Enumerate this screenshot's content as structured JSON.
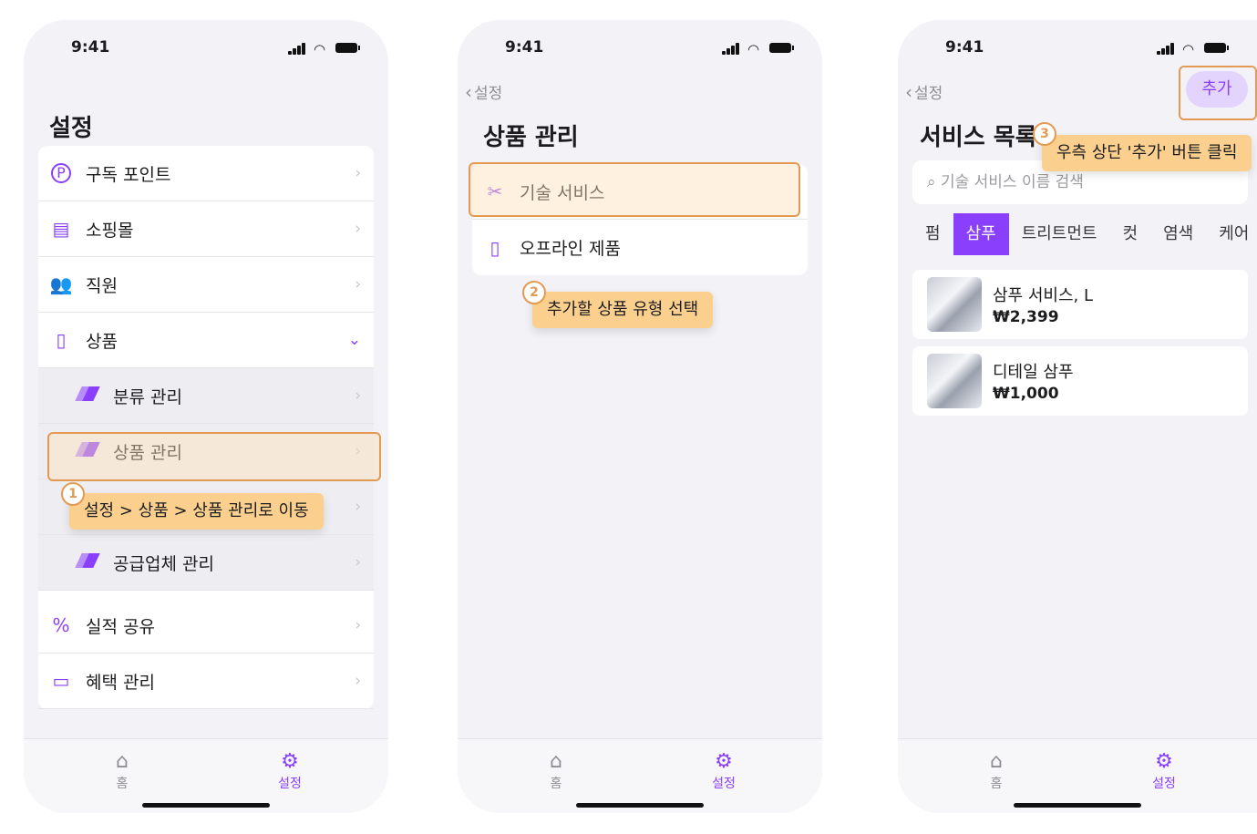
{
  "status": {
    "time": "9:41"
  },
  "screen1": {
    "title": "설정",
    "items": [
      {
        "label": "구독 포인트"
      },
      {
        "label": "소핑몰"
      },
      {
        "label": "직원"
      },
      {
        "label": "상품"
      }
    ],
    "sub_items": [
      {
        "label": "분류 관리"
      },
      {
        "label": "상품 관리"
      },
      {
        "label": "공급업체 관리"
      }
    ],
    "items2": [
      {
        "label": "실적 공유"
      },
      {
        "label": "혜택 관리"
      }
    ],
    "tip": "설정 > 상품 > 상품 관리로 이동",
    "step": "1"
  },
  "screen2": {
    "back": "설정",
    "title": "상품 관리",
    "items": [
      {
        "label": "기술 서비스"
      },
      {
        "label": "오프라인 제품"
      }
    ],
    "tip": "추가할 상품 유형 선택",
    "step": "2"
  },
  "screen3": {
    "back": "설정",
    "title": "서비스 목록",
    "add": "추가",
    "tip": "우측 상단 '추가' 버튼 클릭",
    "step": "3",
    "search_placeholder": "기술 서비스 이름 검색",
    "chips": [
      "펌",
      "삼푸",
      "트리트먼트",
      "컷",
      "염색",
      "케어"
    ],
    "active_chip": "삼푸",
    "products": [
      {
        "name": "삼푸 서비스, L",
        "price": "₩2,399"
      },
      {
        "name": "디테일 삼푸",
        "price": "₩1,000"
      }
    ]
  },
  "tabs": {
    "home": "홈",
    "settings": "설정"
  },
  "colors": {
    "accent": "#8a3ffc",
    "highlight": "#e39a52",
    "tip": "#fbd08e"
  }
}
